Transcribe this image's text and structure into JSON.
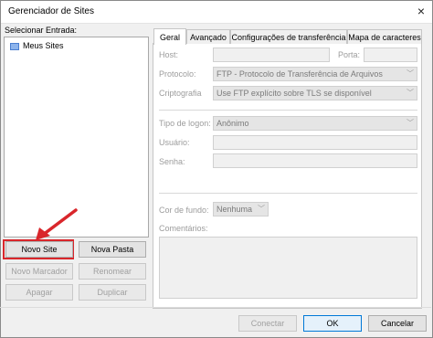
{
  "window": {
    "title": "Gerenciador de Sites",
    "close_glyph": "×"
  },
  "left": {
    "select_label": "Selecionar Entrada:",
    "tree": [
      {
        "label": "Meus Sites",
        "icon": "folder-icon"
      }
    ],
    "buttons": {
      "new_site": "Novo Site",
      "new_folder": "Nova Pasta",
      "new_bookmark": "Novo Marcador",
      "rename": "Renomear",
      "delete": "Apagar",
      "duplicate": "Duplicar"
    }
  },
  "tabs": [
    {
      "label": "Geral",
      "active": true
    },
    {
      "label": "Avançado",
      "active": false
    },
    {
      "label": "Configurações de transferência",
      "active": false
    },
    {
      "label": "Mapa de caracteres",
      "active": false
    }
  ],
  "general": {
    "host_label": "Host:",
    "host_value": "",
    "port_label": "Porta:",
    "port_value": "",
    "protocol_label": "Protocolo:",
    "protocol_value": "FTP - Protocolo de Transferência de Arquivos",
    "encryption_label": "Criptografia",
    "encryption_value": "Use FTP explícito sobre TLS se disponível",
    "logon_type_label": "Tipo de logon:",
    "logon_type_value": "Anônimo",
    "user_label": "Usuário:",
    "user_value": "",
    "password_label": "Senha:",
    "password_value": "",
    "bg_color_label": "Cor de fundo:",
    "bg_color_value": "Nenhuma",
    "comments_label": "Comentários:",
    "comments_value": ""
  },
  "footer": {
    "connect": "Conectar",
    "ok": "OK",
    "cancel": "Cancelar"
  },
  "colors": {
    "highlight_box": "#d9262b",
    "arrow": "#d9262b",
    "primary_border": "#0078d7"
  }
}
